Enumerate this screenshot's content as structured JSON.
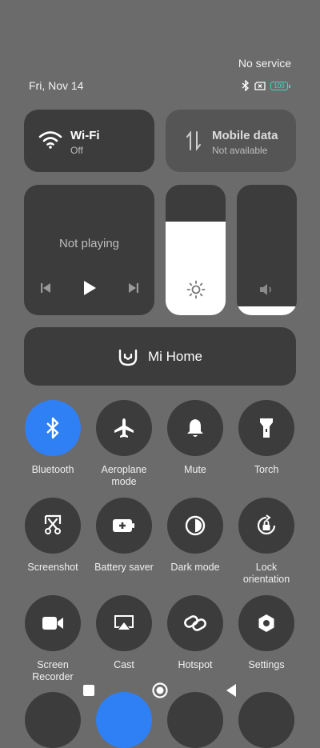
{
  "status": {
    "carrier": "No service",
    "date": "Fri, Nov 14",
    "battery_level": "100",
    "icons": [
      "bluetooth-icon",
      "no-sim-icon",
      "battery-icon"
    ]
  },
  "colors": {
    "accent": "#2f7ff5",
    "tile": "#3c3c3c",
    "background": "#6b6b6b",
    "battery": "#3ddcc0"
  },
  "wifi": {
    "title": "Wi-Fi",
    "status": "Off"
  },
  "mobile_data": {
    "title": "Mobile data",
    "status": "Not available"
  },
  "media": {
    "status": "Not playing"
  },
  "brightness": {
    "level_fraction": 0.72
  },
  "volume": {
    "level_fraction": 0.07
  },
  "mi_home": {
    "label": "Mi Home"
  },
  "toggles": [
    {
      "label": "Bluetooth",
      "icon": "bluetooth-icon",
      "on": true
    },
    {
      "label": "Aeroplane mode",
      "icon": "airplane-icon",
      "on": false
    },
    {
      "label": "Mute",
      "icon": "bell-icon",
      "on": false
    },
    {
      "label": "Torch",
      "icon": "flashlight-icon",
      "on": false
    },
    {
      "label": "Screenshot",
      "icon": "screenshot-icon",
      "on": false
    },
    {
      "label": "Battery saver",
      "icon": "battery-saver-icon",
      "on": false
    },
    {
      "label": "Dark mode",
      "icon": "dark-mode-icon",
      "on": false
    },
    {
      "label": "Lock orientation",
      "icon": "lock-rotation-icon",
      "on": false
    },
    {
      "label": "Screen Recorder",
      "icon": "video-camera-icon",
      "on": false
    },
    {
      "label": "Cast",
      "icon": "cast-icon",
      "on": false
    },
    {
      "label": "Hotspot",
      "icon": "link-icon",
      "on": false
    },
    {
      "label": "Settings",
      "icon": "settings-icon",
      "on": false
    }
  ]
}
